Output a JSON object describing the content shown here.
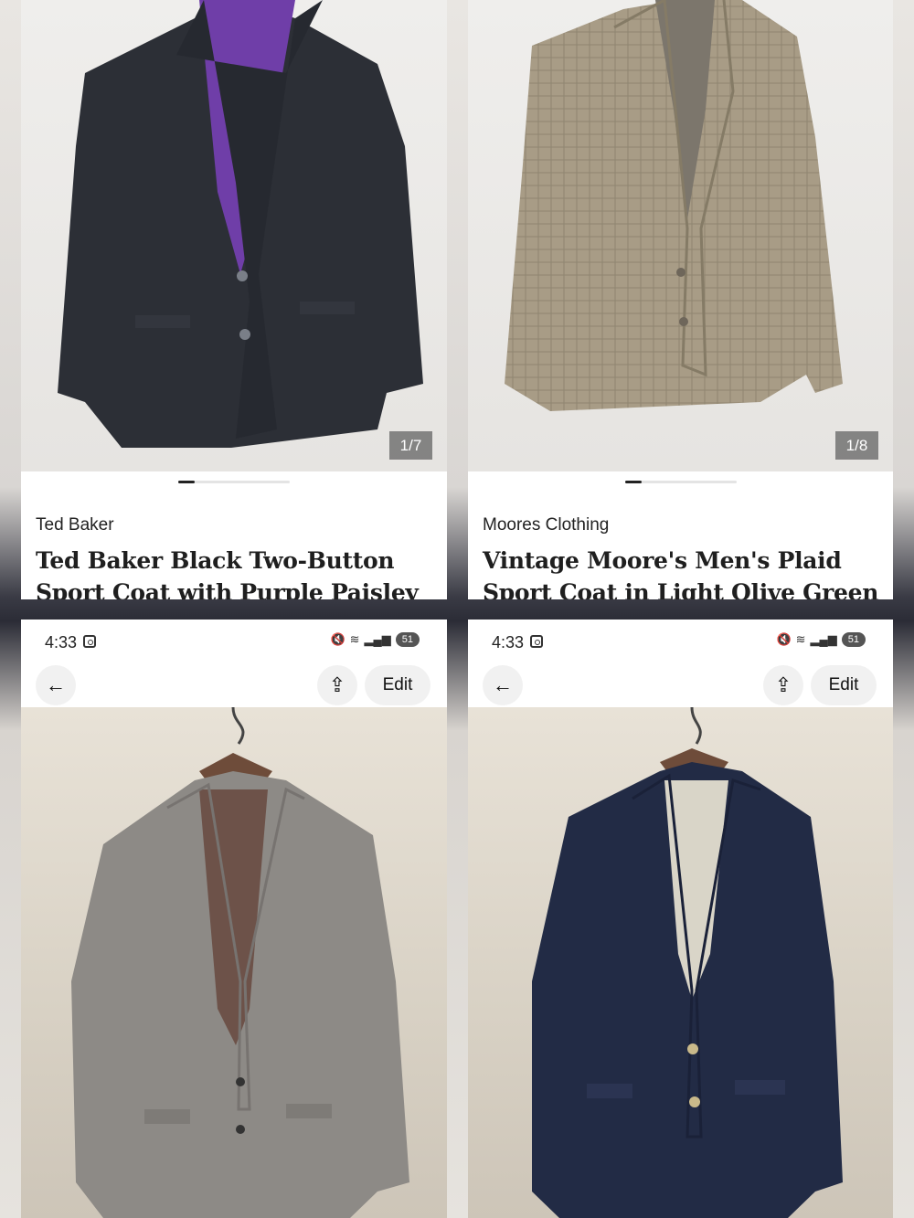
{
  "listings": [
    {
      "brand": "Ted Baker",
      "title": "Ted Baker Black Two-Button Sport Coat with Purple Paisley Lining",
      "counter": "1/7"
    },
    {
      "brand": "Moores Clothing",
      "title": "Vintage Moore's Men's Plaid Sport Coat in Light Olive Green Glencheck",
      "counter": "1/8"
    }
  ],
  "phones": [
    {
      "time": "4:33",
      "battery": "51",
      "edit_label": "Edit",
      "back_icon": "←",
      "share_icon": "⇪"
    },
    {
      "time": "4:33",
      "battery": "51",
      "edit_label": "Edit",
      "back_icon": "←",
      "share_icon": "⇪"
    }
  ],
  "colors": {
    "black_coat": "#2c2f36",
    "purple_lining": "#6f3ea8",
    "olive_plaid": "#a89c86",
    "grey_tweed": "#8d8a86",
    "navy_blazer": "#222b45"
  }
}
